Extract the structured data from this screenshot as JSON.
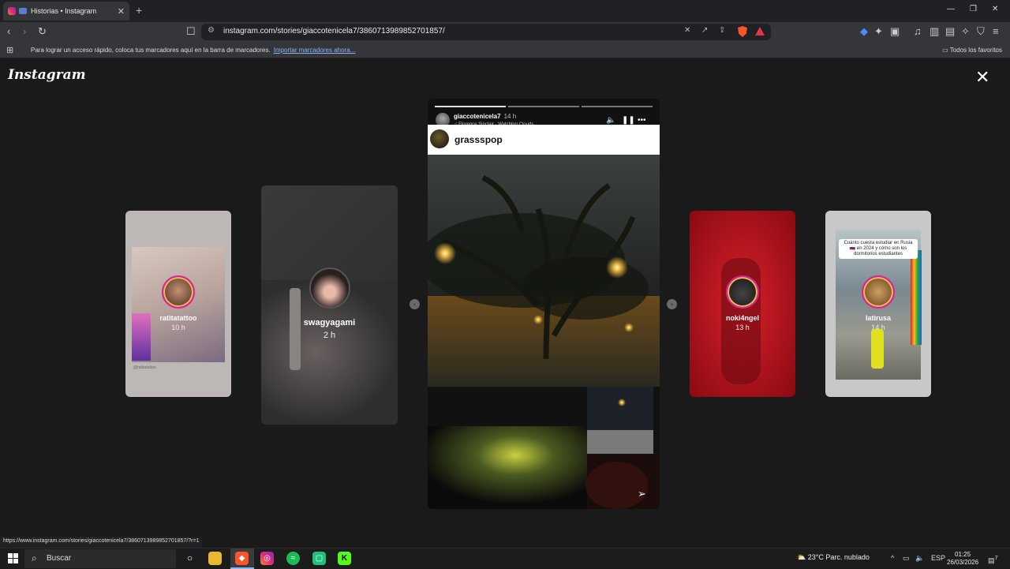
{
  "browser": {
    "tab_title": "Historias • Instagram",
    "url": "instagram.com/stories/giaccotenicela7/3860713989852701857/",
    "bookmarks_prompt": "Para lograr un acceso rápido, coloca tus marcadores aquí en la barra de marcadores.",
    "bookmarks_import_link": "Importar marcadores ahora...",
    "all_bookmarks": "Todos los favoritos",
    "status_url": "https://www.instagram.com/stories/giaccotenicela7/3860713989852701857/?r=1"
  },
  "instagram": {
    "logo": "Instagram",
    "current_story": {
      "username": "giaccotenicela7",
      "time": "14 h",
      "music": "♫ Florence Sinclair · Watching Clouds",
      "mention": "grassspop",
      "progress_segments": 3,
      "progress_done": 0
    },
    "side_stories": [
      {
        "username": "ratitatattoo",
        "time": "10 h",
        "caption": "@ratitatattoo"
      },
      {
        "username": "swagyagami",
        "time": "2 h"
      },
      {
        "username": "noki4ngel",
        "time": "13 h"
      },
      {
        "username": "latirusa",
        "time": "14 h",
        "caption": "Cuánto cuesta estudiar en Rusia 🇷🇺 en 2024 y cómo son los dormitorios estudiantes"
      }
    ]
  },
  "taskbar": {
    "search_placeholder": "Buscar",
    "weather_temp": "23°C",
    "weather_desc": "Parc. nublado",
    "language": "ESP",
    "time": "01:25",
    "date": "26/03/2026",
    "notifications": "7"
  },
  "colors": {
    "page_bg": "#1a1a1a",
    "chrome_bg": "#35363a",
    "tab_bg": "#202124",
    "link": "#8ab4f8",
    "ig_ring": "#d6249f",
    "brave": "#fb542b"
  }
}
